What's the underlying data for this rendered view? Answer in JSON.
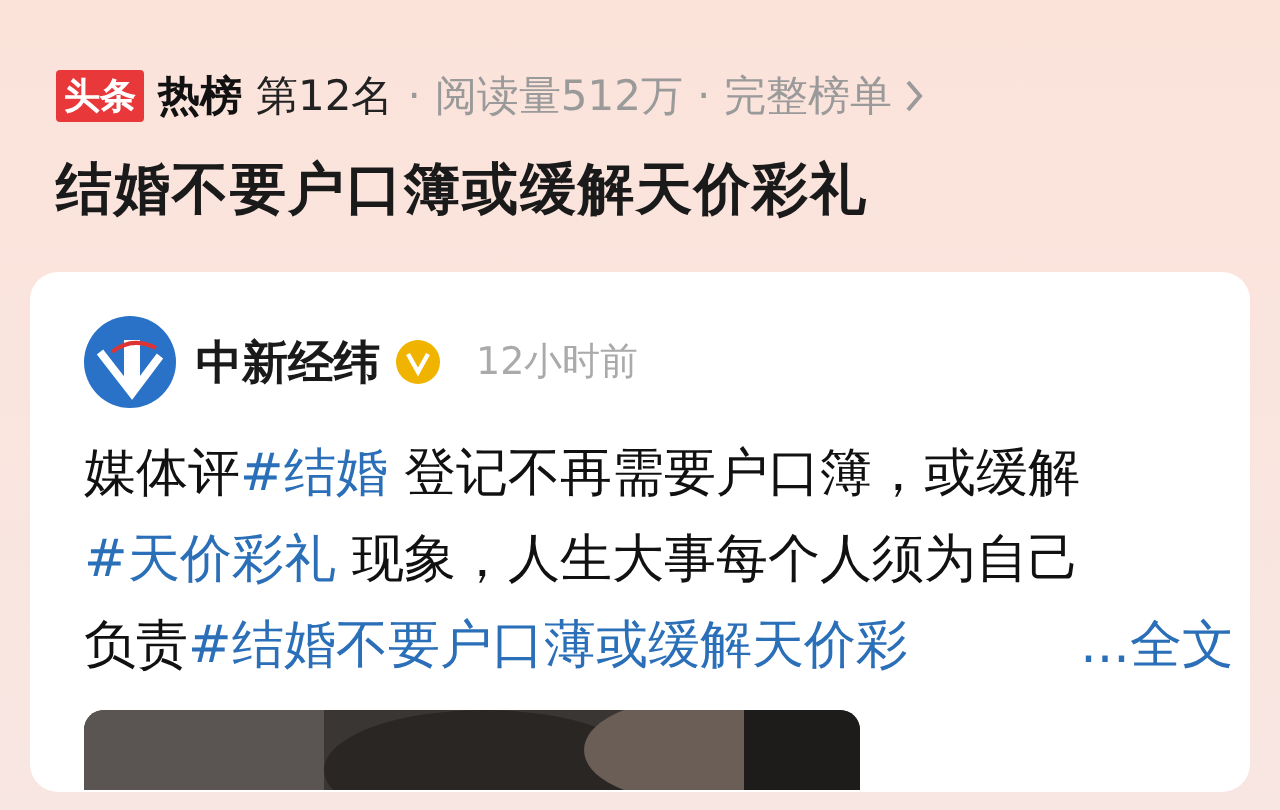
{
  "hot_list": {
    "badge": "头条",
    "brand": "热榜",
    "rank": "第12名",
    "separator_1": "·",
    "reads": "阅读量512万",
    "separator_2": "·",
    "full_list_link": "完整榜单"
  },
  "topic_title": "结婚不要户口簿或缓解天价彩礼",
  "post": {
    "author": "中新经纬",
    "verified": true,
    "time": "12小时前",
    "lines": [
      [
        {
          "kind": "text",
          "text": "媒体评"
        },
        {
          "kind": "hashtag",
          "text": "#结婚"
        },
        {
          "kind": "text",
          "text": " 登记不再需要户口簿，或缓解"
        }
      ],
      [
        {
          "kind": "hashtag",
          "text": "#天价彩礼"
        },
        {
          "kind": "text",
          "text": " 现象，人生大事每个人须为自己"
        }
      ],
      [
        {
          "kind": "text",
          "text": "负责"
        },
        {
          "kind": "hashtag",
          "text": "#结婚不要户口薄或缓解天价彩"
        }
      ]
    ],
    "more_link": "...全文",
    "media": {
      "kind": "picture"
    }
  }
}
